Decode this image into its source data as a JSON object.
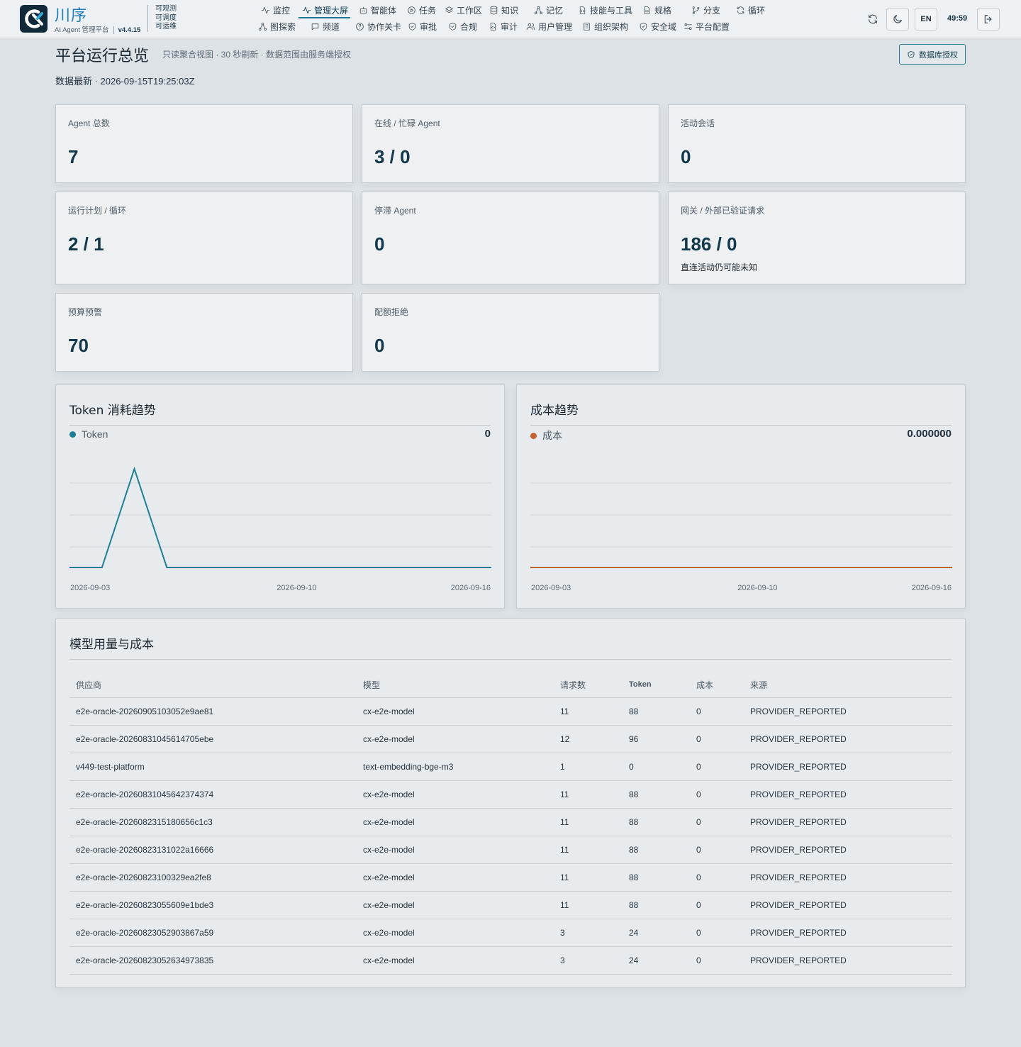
{
  "brand": {
    "name": "川序",
    "subtitle": "AI Agent 管理平台",
    "version": "v4.4.15",
    "tags": [
      "可观测",
      "可调度",
      "可运维"
    ]
  },
  "nav": {
    "row1": [
      {
        "label": "监控",
        "icon": "activity-icon"
      },
      {
        "label": "管理大屏",
        "icon": "activity-icon",
        "active": true
      },
      {
        "label": "智能体",
        "icon": "bot-icon"
      },
      {
        "label": "任务",
        "icon": "play-circle-icon"
      },
      {
        "label": "工作区",
        "icon": "layers-icon"
      },
      {
        "label": "知识",
        "icon": "database-icon"
      },
      {
        "label": "记忆",
        "icon": "network-icon"
      },
      {
        "label": "技能与工具",
        "icon": "file-code-icon"
      },
      {
        "label": "规格",
        "icon": "file-code-icon"
      },
      {
        "label": "分支",
        "icon": "git-branch-icon"
      },
      {
        "label": "循环",
        "icon": "refresh-icon"
      }
    ],
    "row2": [
      {
        "label": "图探索",
        "icon": "network-icon"
      },
      {
        "label": "频道",
        "icon": "message-icon"
      },
      {
        "label": "协作关卡",
        "icon": "help-circle-icon"
      },
      {
        "label": "审批",
        "icon": "shield-check-icon"
      },
      {
        "label": "合规",
        "icon": "shield-check-icon"
      },
      {
        "label": "审计",
        "icon": "file-code-icon"
      },
      {
        "label": "用户管理",
        "icon": "users-icon"
      },
      {
        "label": "组织架构",
        "icon": "building-icon"
      },
      {
        "label": "安全域",
        "icon": "shield-check-icon"
      },
      {
        "label": "平台配置",
        "icon": "sliders-icon"
      }
    ]
  },
  "toolbar": {
    "refresh_icon": "refresh-icon",
    "theme_icon": "moon-icon",
    "lang_label": "EN",
    "session_timer": "49:59",
    "logout_icon": "logout-icon"
  },
  "header": {
    "title": "平台运行总览",
    "description": "只读聚合视图 · 30 秒刷新 · 数据范围由服务端授权",
    "freshness": "数据最新 · 2026-09-15T19:25:03Z",
    "db_auth_label": "数据库授权"
  },
  "stats": [
    {
      "label": "Agent 总数",
      "value": "7"
    },
    {
      "label": "在线 / 忙碌 Agent",
      "value": "3 / 0"
    },
    {
      "label": "活动会话",
      "value": "0"
    },
    {
      "label": "运行计划 / 循环",
      "value": "2 / 1"
    },
    {
      "label": "停滞 Agent",
      "value": "0"
    },
    {
      "label": "网关 / 外部已验证请求",
      "value": "186 / 0",
      "note": "直连活动仍可能未知"
    },
    {
      "label": "预算预警",
      "value": "70"
    },
    {
      "label": "配额拒绝",
      "value": "0"
    }
  ],
  "token_chart": {
    "title": "Token 消耗趋势",
    "legend": "Token",
    "legend_value": "0",
    "color": "#1f7e95"
  },
  "cost_chart": {
    "title": "成本趋势",
    "legend": "成本",
    "legend_value": "0.000000",
    "color": "#c2612d"
  },
  "chart_data": [
    {
      "type": "line",
      "title": "Token 消耗趋势",
      "x": [
        "2026-09-03",
        "2026-09-04",
        "2026-09-05",
        "2026-09-06",
        "2026-09-07",
        "2026-09-08",
        "2026-09-09",
        "2026-09-10",
        "2026-09-11",
        "2026-09-12",
        "2026-09-13",
        "2026-09-14",
        "2026-09-15",
        "2026-09-16"
      ],
      "x_ticks": [
        "2026-09-03",
        "2026-09-10",
        "2026-09-16"
      ],
      "series": [
        {
          "name": "Token",
          "values": [
            0,
            0,
            560,
            0,
            0,
            0,
            0,
            0,
            0,
            0,
            0,
            0,
            0,
            0
          ]
        }
      ],
      "ylim": [
        0,
        600
      ],
      "grid": true
    },
    {
      "type": "line",
      "title": "成本趋势",
      "x": [
        "2026-09-03",
        "2026-09-04",
        "2026-09-05",
        "2026-09-06",
        "2026-09-07",
        "2026-09-08",
        "2026-09-09",
        "2026-09-10",
        "2026-09-11",
        "2026-09-12",
        "2026-09-13",
        "2026-09-14",
        "2026-09-15",
        "2026-09-16"
      ],
      "x_ticks": [
        "2026-09-03",
        "2026-09-10",
        "2026-09-16"
      ],
      "series": [
        {
          "name": "成本",
          "values": [
            0,
            0,
            0,
            0,
            0,
            0,
            0,
            0,
            0,
            0,
            0,
            0,
            0,
            0
          ]
        }
      ],
      "ylim": [
        0,
        1
      ],
      "grid": true
    }
  ],
  "model_table": {
    "title": "模型用量与成本",
    "columns": [
      "供应商",
      "模型",
      "请求数",
      "Token",
      "成本",
      "来源"
    ],
    "rows": [
      [
        "e2e-oracle-20260905103052e9ae81",
        "cx-e2e-model",
        "11",
        "88",
        "0",
        "PROVIDER_REPORTED"
      ],
      [
        "e2e-oracle-20260831045614705ebe",
        "cx-e2e-model",
        "12",
        "96",
        "0",
        "PROVIDER_REPORTED"
      ],
      [
        "v449-test-platform",
        "text-embedding-bge-m3",
        "1",
        "0",
        "0",
        "PROVIDER_REPORTED"
      ],
      [
        "e2e-oracle-20260831045642374374",
        "cx-e2e-model",
        "11",
        "88",
        "0",
        "PROVIDER_REPORTED"
      ],
      [
        "e2e-oracle-2026082315180656c1c3",
        "cx-e2e-model",
        "11",
        "88",
        "0",
        "PROVIDER_REPORTED"
      ],
      [
        "e2e-oracle-20260823131022a16666",
        "cx-e2e-model",
        "11",
        "88",
        "0",
        "PROVIDER_REPORTED"
      ],
      [
        "e2e-oracle-20260823100329ea2fe8",
        "cx-e2e-model",
        "11",
        "88",
        "0",
        "PROVIDER_REPORTED"
      ],
      [
        "e2e-oracle-20260823055609e1bde3",
        "cx-e2e-model",
        "11",
        "88",
        "0",
        "PROVIDER_REPORTED"
      ],
      [
        "e2e-oracle-20260823052903867a59",
        "cx-e2e-model",
        "3",
        "24",
        "0",
        "PROVIDER_REPORTED"
      ],
      [
        "e2e-oracle-20260823052634973835",
        "cx-e2e-model",
        "3",
        "24",
        "0",
        "PROVIDER_REPORTED"
      ]
    ]
  }
}
